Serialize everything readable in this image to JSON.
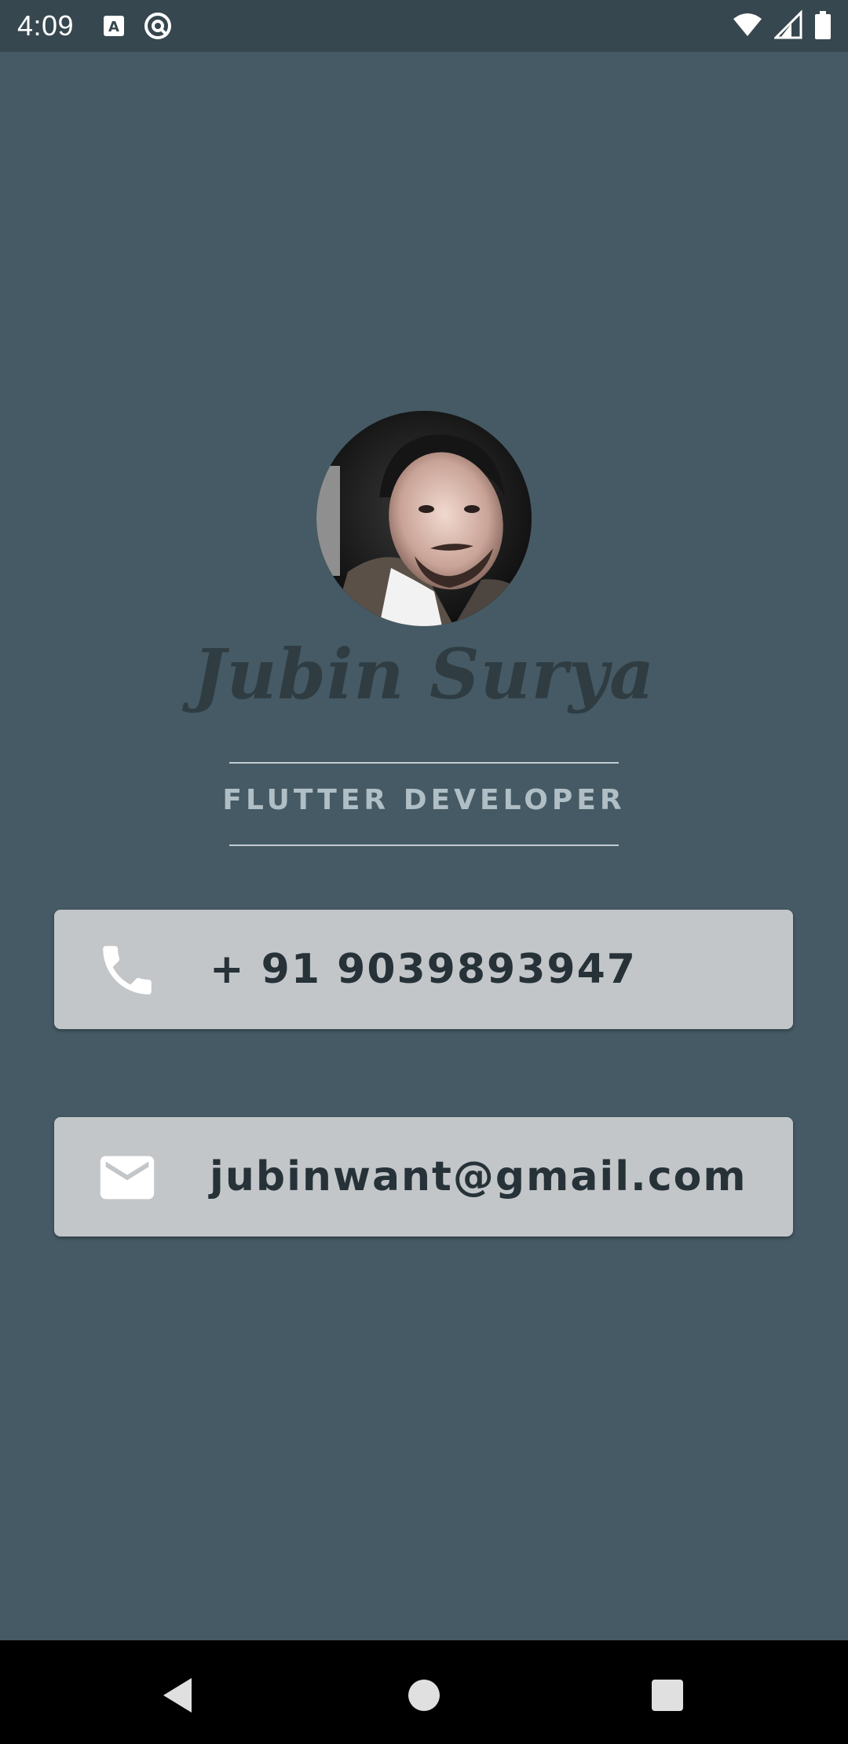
{
  "status_bar": {
    "time": "4:09",
    "icons": [
      "text-a-notification-icon",
      "at-sign-notification-icon",
      "wifi-icon",
      "cellular-signal-icon",
      "battery-icon"
    ]
  },
  "profile": {
    "name": "Jubin Surya",
    "title": "FLUTTER DEVELOPER",
    "avatar": "profile-photo"
  },
  "contacts": {
    "phone": {
      "icon": "phone-icon",
      "text": "+ 91 9039893947"
    },
    "email": {
      "icon": "mail-icon",
      "text": "jubinwant@gmail.com"
    }
  },
  "nav_bar": {
    "buttons": [
      "back-icon",
      "home-icon",
      "recents-icon"
    ]
  },
  "colors": {
    "background": "#455a64",
    "status_bar": "#37474f",
    "card": "#c3c6c9",
    "name_text": "#2f3c42",
    "title_text": "#b0bec5",
    "card_text": "#263238"
  }
}
